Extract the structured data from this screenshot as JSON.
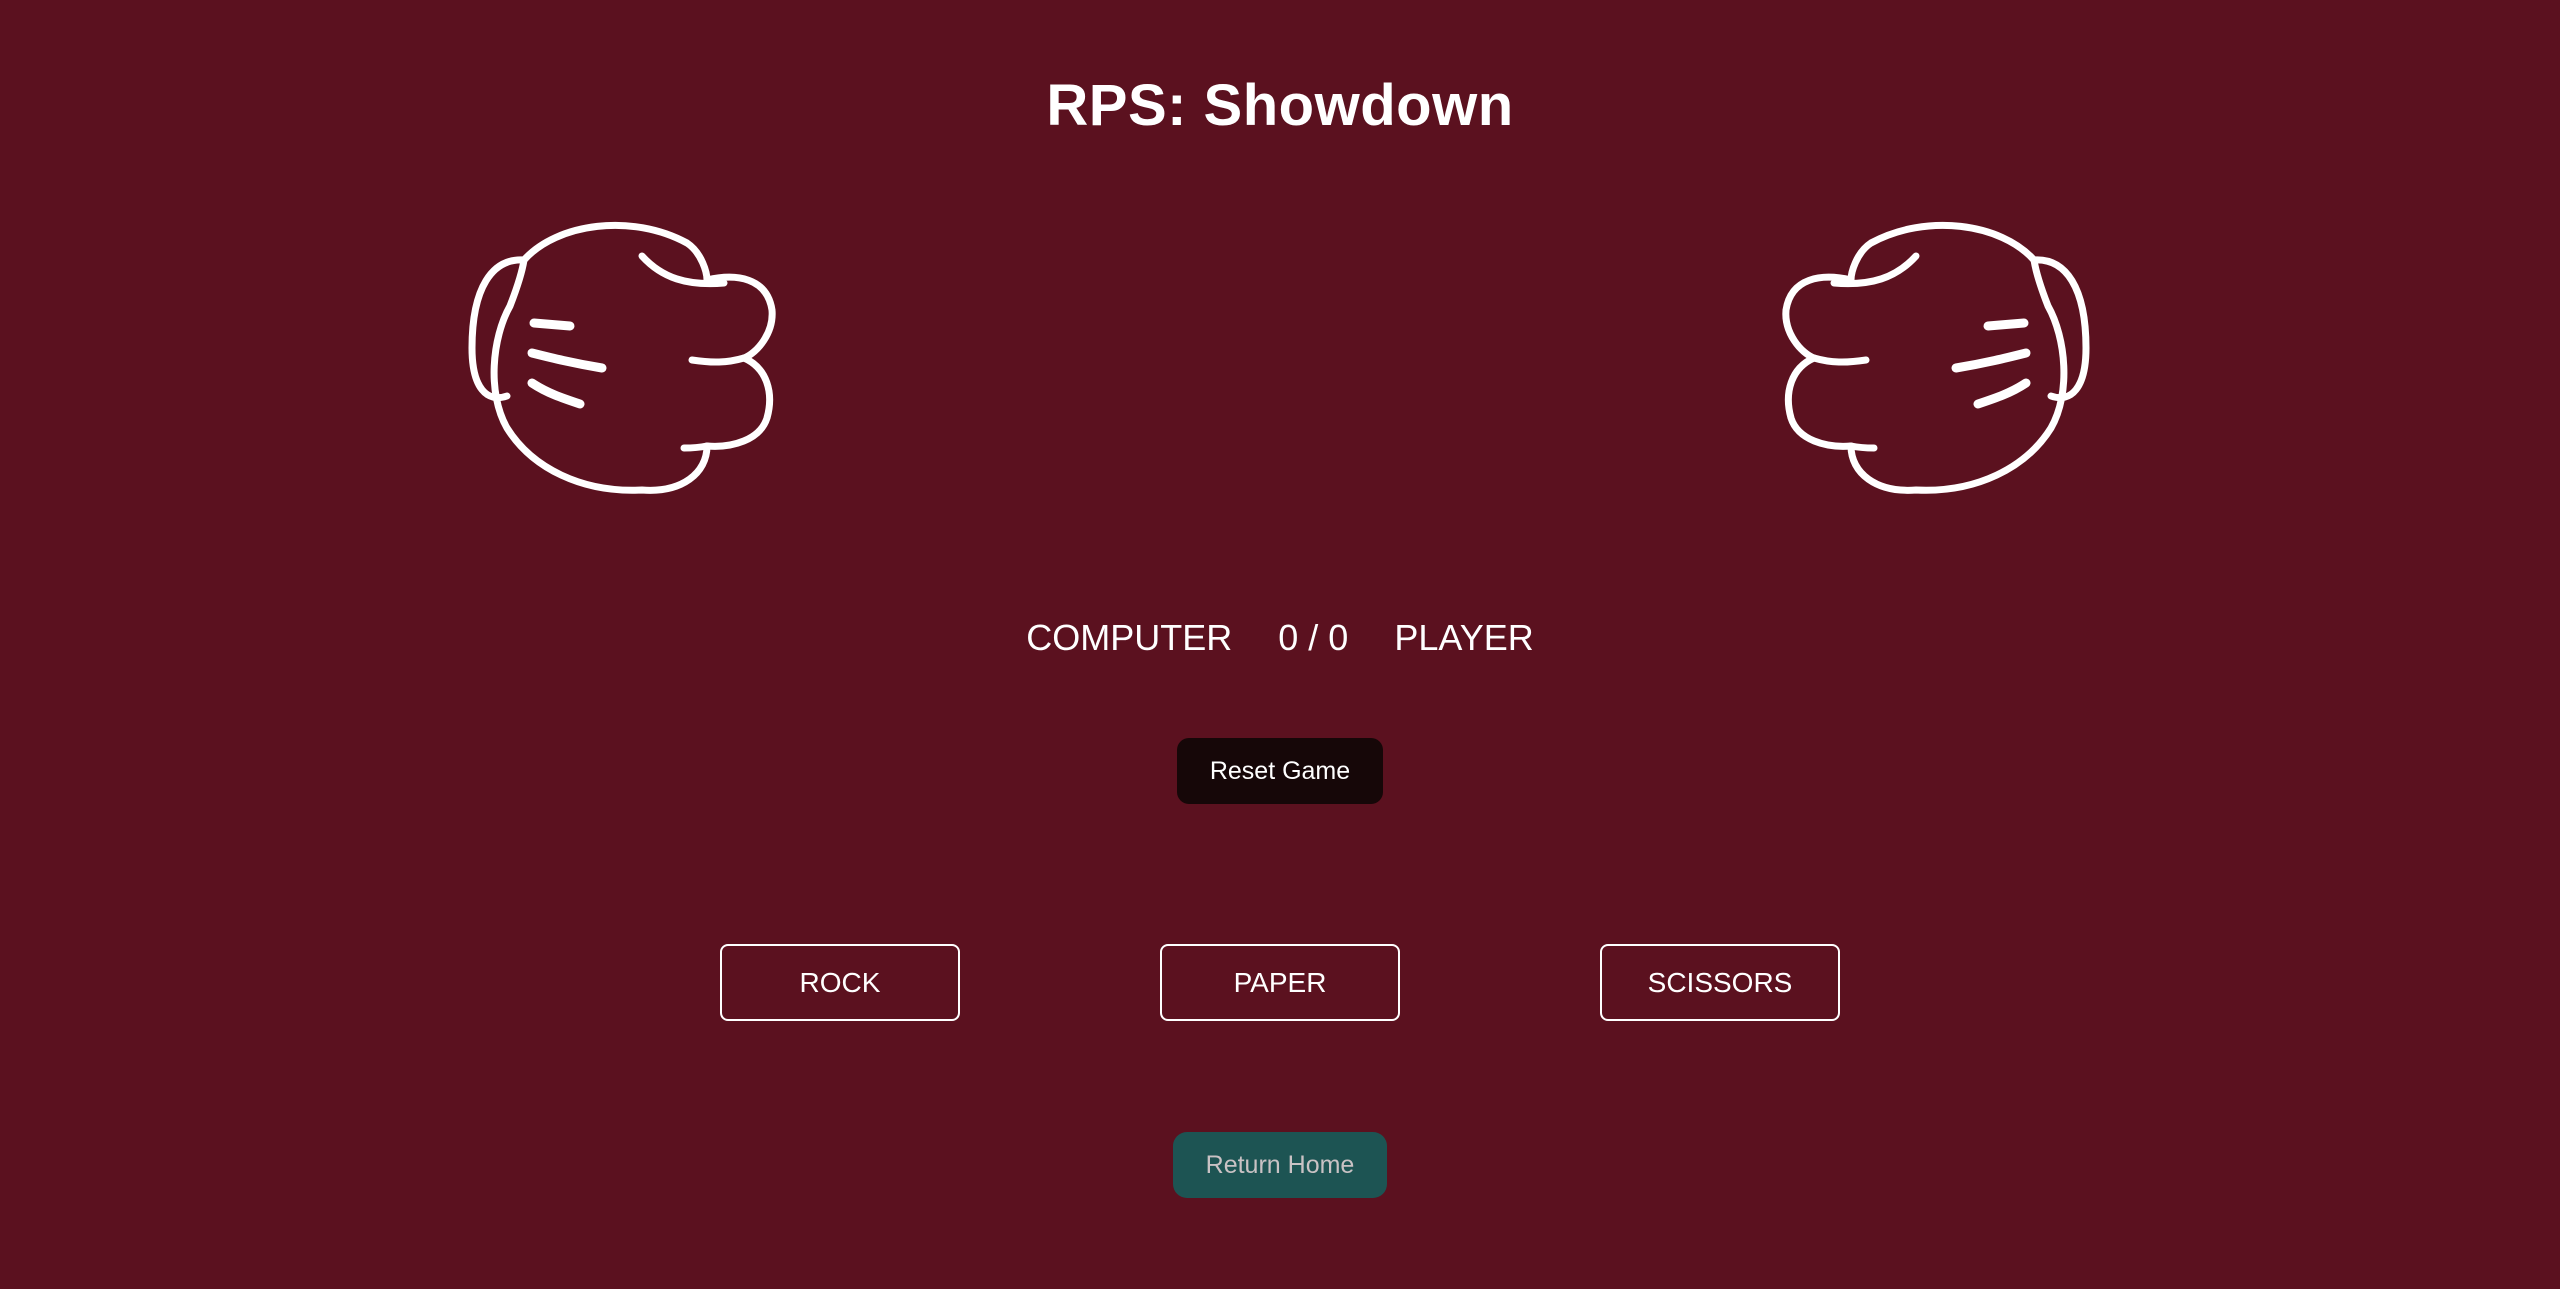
{
  "game": {
    "title": "RPS: Showdown"
  },
  "players": {
    "left_hand_icon": "fist-icon",
    "right_hand_icon": "fist-icon"
  },
  "scoreboard": {
    "computer_label": "COMPUTER",
    "score": "0 / 0",
    "player_label": "PLAYER"
  },
  "controls": {
    "reset_label": "Reset Game",
    "choices": [
      {
        "label": "ROCK"
      },
      {
        "label": "PAPER"
      },
      {
        "label": "SCISSORS"
      }
    ],
    "home_label": "Return Home"
  },
  "colors": {
    "background": "#5b111f",
    "reset_button": "#160708",
    "home_button": "#1d5453",
    "text": "#ffffff"
  }
}
